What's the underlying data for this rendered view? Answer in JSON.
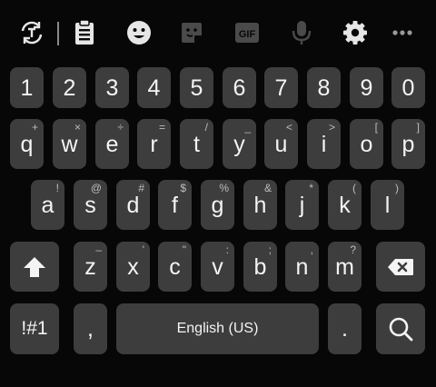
{
  "toolbar": {
    "icons": [
      "translate-icon",
      "clipboard-icon",
      "emoji-icon",
      "sticker-icon",
      "gif-icon",
      "microphone-icon",
      "settings-icon",
      "more-icon"
    ],
    "gif_label": "GIF",
    "enabled_color": "#e6e6e6",
    "disabled_color": "#4a4a4a"
  },
  "rows": {
    "numbers": [
      "1",
      "2",
      "3",
      "4",
      "5",
      "6",
      "7",
      "8",
      "9",
      "0"
    ],
    "top": [
      {
        "key": "q",
        "hint": "+"
      },
      {
        "key": "w",
        "hint": "×"
      },
      {
        "key": "e",
        "hint": "÷"
      },
      {
        "key": "r",
        "hint": "="
      },
      {
        "key": "t",
        "hint": "/"
      },
      {
        "key": "y",
        "hint": "_"
      },
      {
        "key": "u",
        "hint": "<"
      },
      {
        "key": "i",
        "hint": ">"
      },
      {
        "key": "o",
        "hint": "["
      },
      {
        "key": "p",
        "hint": "]"
      }
    ],
    "home": [
      {
        "key": "a",
        "hint": "!"
      },
      {
        "key": "s",
        "hint": "@"
      },
      {
        "key": "d",
        "hint": "#"
      },
      {
        "key": "f",
        "hint": "$"
      },
      {
        "key": "g",
        "hint": "%"
      },
      {
        "key": "h",
        "hint": "&"
      },
      {
        "key": "j",
        "hint": "*"
      },
      {
        "key": "k",
        "hint": "("
      },
      {
        "key": "l",
        "hint": ")"
      }
    ],
    "bottom": [
      {
        "key": "z",
        "hint": "–"
      },
      {
        "key": "x",
        "hint": "'"
      },
      {
        "key": "c",
        "hint": "\""
      },
      {
        "key": "v",
        "hint": ":"
      },
      {
        "key": "b",
        "hint": ";"
      },
      {
        "key": "n",
        "hint": ","
      },
      {
        "key": "m",
        "hint": "?"
      }
    ]
  },
  "bottom_bar": {
    "symbols_label": "!#1",
    "comma_label": ",",
    "space_label": "English (US)",
    "period_label": "."
  },
  "colors": {
    "background": "#070707",
    "key": "#3d3d3d",
    "function_key": "#2c2c2c",
    "text": "#f4f4f4",
    "hint": "#bdbdbd"
  }
}
